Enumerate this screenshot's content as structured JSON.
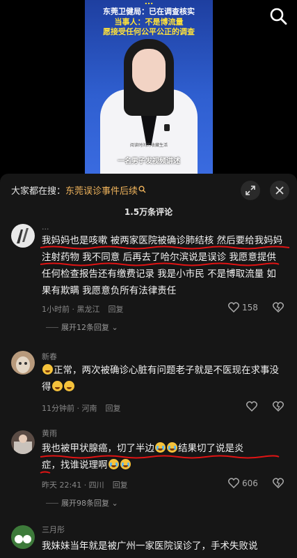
{
  "video": {
    "headline_top": "...",
    "headline_1": "东莞卫健局：已在调查核实",
    "headline_2": "当事人：不是博流量",
    "headline_3": "愿接受任何公平公正的调查",
    "subtitle": "一名男子发视频讲述",
    "watermark": "阅读时间的收藏生活"
  },
  "search_icon": "search-icon",
  "sheet": {
    "search_prefix": "大家都在搜：",
    "search_query": "东莞误诊事件后续",
    "count_label": "1.5万条评论",
    "colors": {
      "accent": "#f0b45c",
      "underline": "#e01414"
    }
  },
  "comments": [
    {
      "user": "...",
      "text": "我妈妈也是咳嗽 被两家医院被确诊肺结核 然后要给我妈妈注射药物 我不同意 后再去了哈尔滨说是误诊 我愿意提供任何检查报告还有缴费记录 我是小市民 不是博取流量 如果有欺瞒 我愿意负所有法律责任",
      "meta": "1小时前 · 黑龙江",
      "reply": "回复",
      "likes": "158",
      "expand": "展开12条回复"
    },
    {
      "user": "新春",
      "text_main": "正常，两次被确诊心脏有问题老子就是不医现在求事没得",
      "meta": "11分钟前 · 河南",
      "reply": "回复",
      "likes": ""
    },
    {
      "user": "黄雨",
      "text_a": "我也被甲状腺癌，切了半边",
      "text_b": "结果切了说是炎",
      "text_c": "症，找谁说理啊",
      "meta": "昨天 22:41 · 四川",
      "reply": "回复",
      "likes": "606",
      "expand": "展开98条回复"
    },
    {
      "user": "三月彤",
      "text": "我妹妹当年就是被广州一家医院误诊了，手术失败说"
    }
  ]
}
